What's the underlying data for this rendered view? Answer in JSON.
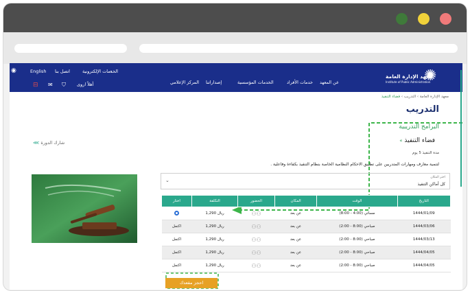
{
  "nav": {
    "lang": "English",
    "contact": "اتصل بنا",
    "eservices": "الخدمات الإلكترونية",
    "user": "أهلاً اروى",
    "links": [
      "عن المعهد",
      "خدمات الأفراد",
      "الخدمات المؤسسية",
      "إصداراتنا",
      "المركز الإعلامي"
    ],
    "logo_ar": "معهد الإدارة العامة",
    "logo_en": "Institute of Public Administration"
  },
  "breadcrumb": [
    "معهد الإدارة العامة",
    "التدريب",
    "فضاء التنفيذ"
  ],
  "page": {
    "title": "التدريب",
    "subtitle": "البرامج التدريبية",
    "program_title": "فضاء التنفيذ",
    "duration": "مدة التنفيذ 5 يوم",
    "description": "لتنمية معارف ومهارات المتدربين على تطبيق الاحكام النظامية الخاصة بنظام التنفيذ بكفاءة وفاعلية .",
    "share": "شارك الدورة"
  },
  "filter": {
    "label": "اختر المكان",
    "value": "كل أماكن التنفيذ"
  },
  "table": {
    "headers": [
      "التاريخ",
      "الوقت",
      "المكان",
      "الحضور",
      "التكلفة",
      "اختار"
    ],
    "rows": [
      {
        "date": "1444/01/09",
        "time": "مسائي (4:00 - 8:00)",
        "place": "عن بعد",
        "cost": "1,290 ريال",
        "action": ""
      },
      {
        "date": "1444/03/06",
        "time": "صباحي (8:00 - 2:00)",
        "place": "عن بعد",
        "cost": "1,290 ريال",
        "action": "اكتمل"
      },
      {
        "date": "1444/03/13",
        "time": "صباحي (8:00 - 2:00)",
        "place": "عن بعد",
        "cost": "1,290 ريال",
        "action": "اكتمل"
      },
      {
        "date": "1444/04/05",
        "time": "صباحي (8:00 - 2:00)",
        "place": "عن بعد",
        "cost": "1,290 ريال",
        "action": "اكتمل"
      },
      {
        "date": "1444/04/05",
        "time": "صباحي (8:00 - 2:00)",
        "place": "عن بعد",
        "cost": "1,290 ريال",
        "action": "اكتمل"
      }
    ]
  },
  "book_label": "احجز مقعدك",
  "colors": {
    "nav": "#1a2e8a",
    "accent": "#2aa88c",
    "button": "#e7a125",
    "highlight": "#3cb54a"
  }
}
